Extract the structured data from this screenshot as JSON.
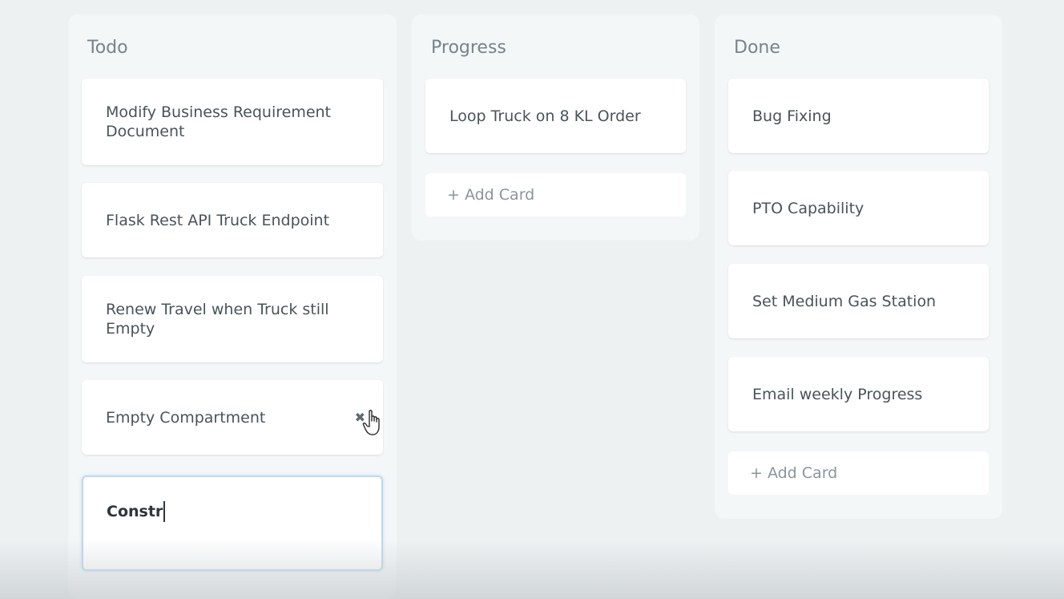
{
  "columns": {
    "todo": {
      "title": "Todo",
      "cards": [
        "Modify Business Requirement Document",
        "Flask Rest API Truck Endpoint",
        "Renew Travel when Truck still Empty",
        "Empty Compartment"
      ],
      "editing_card_value": "Constr"
    },
    "progress": {
      "title": "Progress",
      "cards": [
        "Loop Truck on 8 KL Order"
      ],
      "add_card_label": "+ Add Card"
    },
    "done": {
      "title": "Done",
      "cards": [
        "Bug Fixing",
        "PTO Capability",
        "Set Medium Gas Station",
        "Email weekly Progress"
      ],
      "add_card_label": "+ Add Card"
    }
  },
  "icons": {
    "delete": "close-icon",
    "cursor": "hand-pointer-icon"
  },
  "colors": {
    "background": "#edf1f2",
    "column": "#f4f7f8",
    "card": "#ffffff",
    "edit_border": "#bcd9ef"
  }
}
